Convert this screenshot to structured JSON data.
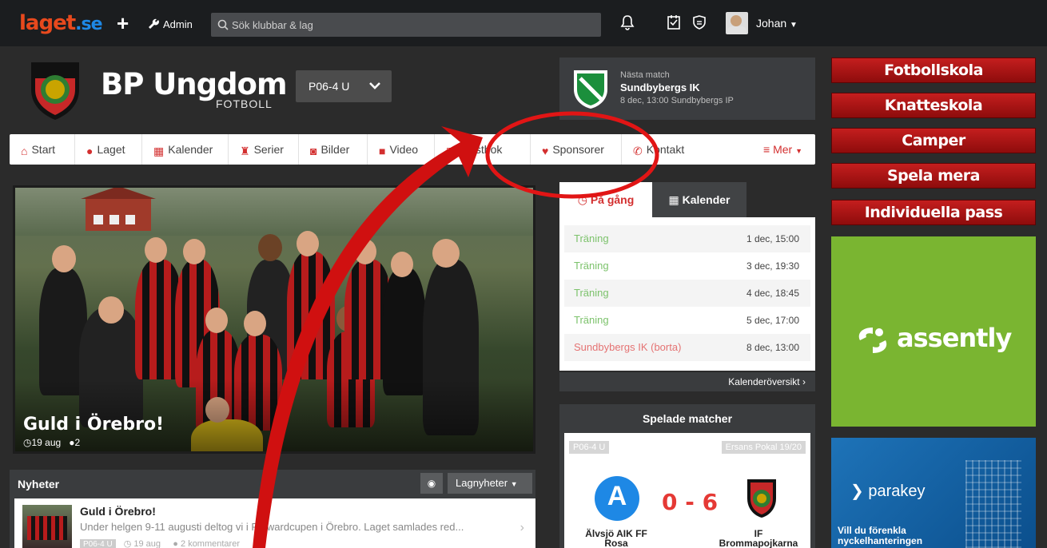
{
  "topbar": {
    "logo_main": "laget",
    "logo_dot": ".se",
    "plus": "+",
    "admin": "Admin",
    "search_placeholder": "Sök klubbar & lag",
    "user": "Johan"
  },
  "header": {
    "team_title": "BP Ungdom",
    "team_subtitle": "FOTBOLL",
    "team_select": "P06-4 U"
  },
  "next_match": {
    "label": "Nästa match",
    "team": "Sundbybergs IK",
    "info": "8 dec, 13:00 Sundbybergs IP"
  },
  "nav": {
    "items": [
      {
        "label": "Start"
      },
      {
        "label": "Laget"
      },
      {
        "label": "Kalender"
      },
      {
        "label": "Serier"
      },
      {
        "label": "Bilder"
      },
      {
        "label": "Video"
      },
      {
        "label": "Gästbok"
      },
      {
        "label": "Sponsorer"
      },
      {
        "label": "Kontakt"
      }
    ],
    "more": "Mer"
  },
  "hero": {
    "title": "Guld i Örebro!",
    "date": "19 aug",
    "comments": "2"
  },
  "news": {
    "heading": "Nyheter",
    "filter": "Lagnyheter",
    "item": {
      "title": "Guld i Örebro!",
      "excerpt": "Under helgen 9-11 augusti deltog vi i Forwardcupen i Örebro. Laget samlades red...",
      "tag": "P06-4 U",
      "date": "19 aug",
      "comments": "2 kommentarer"
    }
  },
  "schedule": {
    "tab_active": "På gång",
    "tab_other": "Kalender",
    "rows": [
      {
        "name": "Träning",
        "date": "1 dec, 15:00"
      },
      {
        "name": "Träning",
        "date": "3 dec, 19:30"
      },
      {
        "name": "Träning",
        "date": "4 dec, 18:45"
      },
      {
        "name": "Träning",
        "date": "5 dec, 17:00"
      },
      {
        "name": "Sundbybergs IK (borta)",
        "date": "8 dec, 13:00"
      }
    ],
    "overview_link": "Kalenderöversikt"
  },
  "played": {
    "heading": "Spelade matcher",
    "team_tag": "P06-4 U",
    "cup_tag": "Ersans Pokal 19/20",
    "score": "0 - 6",
    "home": "Älvsjö AIK FF Rosa",
    "away": "IF Brommapojkarna"
  },
  "ads": {
    "buttons": [
      "Fotbollskola",
      "Knatteskola",
      "Camper",
      "Spela mera",
      "Individuella pass"
    ],
    "assently": "assently",
    "parakey": "parakey",
    "parakey_sub": "Vill du förenkla nyckelhanteringen"
  },
  "colors": {
    "accent": "#d32f2f",
    "green": "#7cc26b",
    "brand": "#e8491d"
  }
}
